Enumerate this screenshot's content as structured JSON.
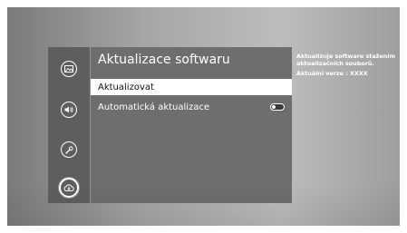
{
  "colors": {
    "panel_bg": "#6e6e6e",
    "sidebar_bg": "#5e5e5e",
    "focus_bg": "#ffffff",
    "text_light": "#ffffff",
    "text_dark": "#111111"
  },
  "sidebar": {
    "items": [
      {
        "icon": "picture-icon"
      },
      {
        "icon": "sound-icon"
      },
      {
        "icon": "support-wrench-icon"
      },
      {
        "icon": "software-update-icon",
        "selected": true
      }
    ]
  },
  "panel": {
    "title": "Aktualizace softwaru",
    "items": [
      {
        "label": "Aktualizovat",
        "focused": true
      },
      {
        "label": "Automatická aktualizace",
        "toggle": "off"
      }
    ]
  },
  "info": {
    "description": "Aktualizuje software stažením aktualizačních souborů.",
    "version": "Aktuální verze : XXXX"
  }
}
